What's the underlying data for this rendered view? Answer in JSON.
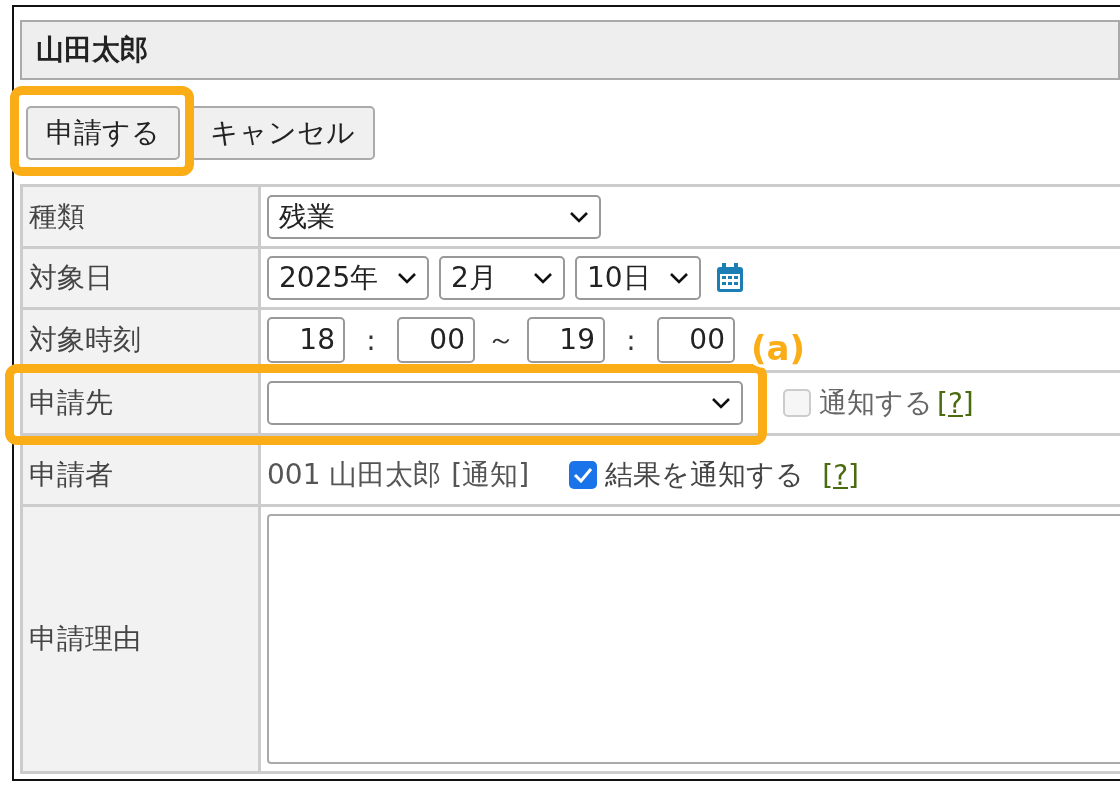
{
  "header": {
    "title": "山田太郎"
  },
  "buttons": [
    {
      "label": "申請する",
      "highlighted": true
    },
    {
      "label": "キャンセル",
      "highlighted": false
    }
  ],
  "form": {
    "rows": [
      {
        "label": "種類",
        "kind": "select",
        "highlighted": false,
        "value": "残業"
      },
      {
        "label": "対象日",
        "kind": "date",
        "highlighted": false,
        "selects": [
          "2025年",
          "2月",
          "10日"
        ]
      },
      {
        "label": "対象時刻",
        "kind": "time",
        "highlighted": false,
        "items": [
          {
            "kind": "field",
            "value": "18"
          },
          {
            "kind": "text",
            "text": ":"
          },
          {
            "kind": "field",
            "value": "00"
          },
          {
            "kind": "text",
            "text": "～"
          },
          {
            "kind": "field",
            "value": "19"
          },
          {
            "kind": "text",
            "text": ":"
          },
          {
            "kind": "field",
            "value": "00"
          }
        ]
      },
      {
        "label": "申請先",
        "kind": "recipient",
        "highlighted": true,
        "callout": "(a)",
        "checkbox": {
          "label": "通知する",
          "checked": false,
          "disabled": true
        },
        "help": "[?]"
      },
      {
        "label": "申請者",
        "kind": "applicant",
        "highlighted": false,
        "text": "001 山田太郎",
        "link": "[通知]",
        "checkbox": {
          "label": "結果を通知する",
          "checked": true,
          "disabled": false
        },
        "help": "[?]"
      },
      {
        "label": "申請理由",
        "kind": "textarea",
        "highlighted": false
      }
    ]
  }
}
